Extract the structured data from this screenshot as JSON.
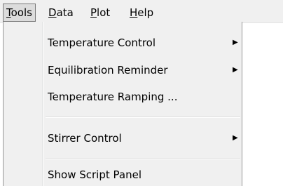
{
  "menubar": {
    "items": [
      {
        "prefix": "",
        "mnemonic": "T",
        "rest": "ools"
      },
      {
        "prefix": "",
        "mnemonic": "D",
        "rest": "ata"
      },
      {
        "prefix": "",
        "mnemonic": "P",
        "rest": "lot"
      },
      {
        "prefix": "",
        "mnemonic": "H",
        "rest": "elp"
      }
    ]
  },
  "tools_menu": {
    "items": [
      {
        "label": "Temperature Control",
        "arrow": "▶"
      },
      {
        "label": "Equilibration Reminder",
        "arrow": "▶"
      },
      {
        "label": "Temperature Ramping ..."
      },
      {
        "label": "Stirrer Control",
        "arrow": "▶"
      },
      {
        "label": "Show Script Panel"
      }
    ]
  },
  "colors": {
    "menu_background": "#f0f0f0",
    "active_item_background": "#dcdcdc",
    "active_item_border": "#7a7a7a"
  }
}
